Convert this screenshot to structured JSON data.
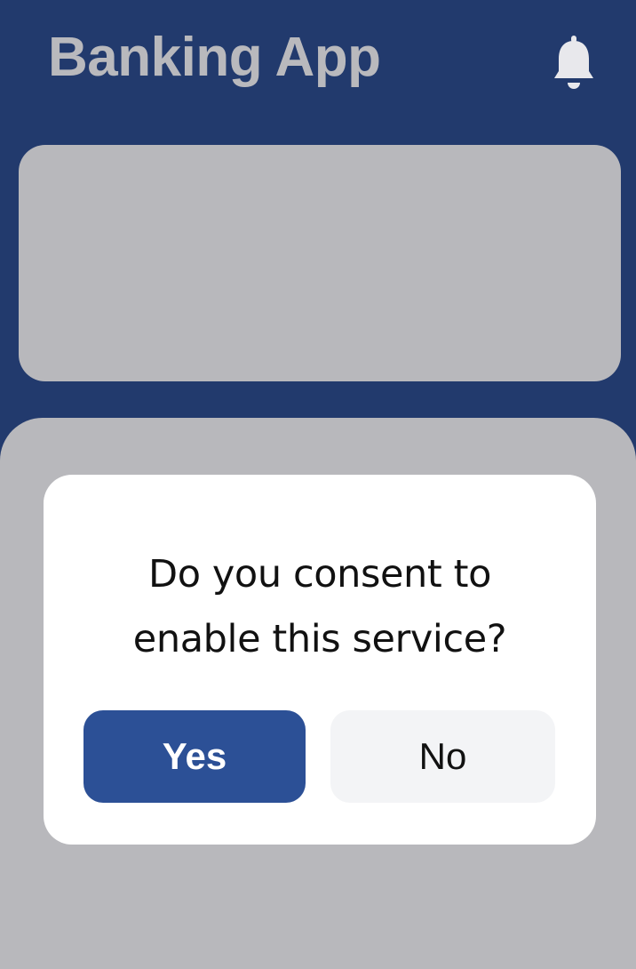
{
  "header": {
    "title": "Banking App",
    "notification_icon": "bell-icon"
  },
  "dialog": {
    "message_line1": "Do you consent to",
    "message_line2": "enable this service?",
    "yes_label": "Yes",
    "no_label": "No"
  },
  "colors": {
    "header_background": "#223a6d",
    "title_text": "#b9b9bd",
    "placeholder_card": "#b8b8bc",
    "dialog_background": "#ffffff",
    "primary_button": "#2c5096",
    "secondary_button": "#f3f4f6"
  }
}
